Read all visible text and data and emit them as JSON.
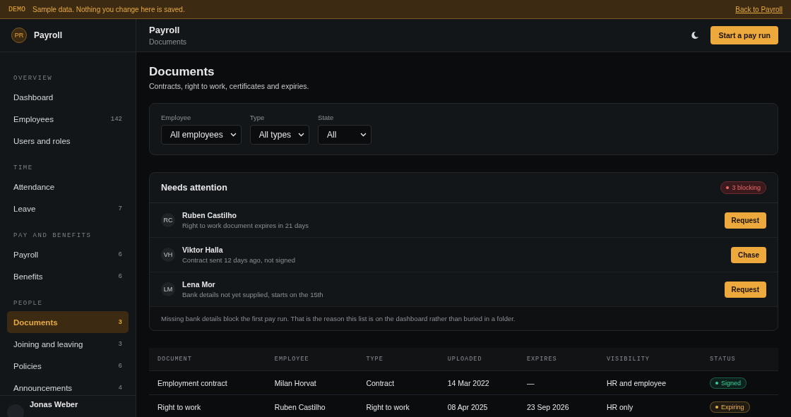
{
  "banner": {
    "tag": "DEMO",
    "message": "Sample data. Nothing you change here is saved.",
    "link": "Back to Payroll"
  },
  "sidebar": {
    "brand": {
      "initials": "PR",
      "name": "Payroll"
    },
    "sections": [
      {
        "title": "OVERVIEW",
        "items": [
          {
            "label": "Dashboard",
            "selected": false
          },
          {
            "label": "Employees",
            "count": "142",
            "selected": false
          },
          {
            "label": "Users and roles",
            "selected": false
          }
        ]
      },
      {
        "title": "TIME",
        "items": [
          {
            "label": "Attendance",
            "selected": false
          },
          {
            "label": "Leave",
            "count": "7",
            "selected": false
          }
        ]
      },
      {
        "title": "PAY AND BENEFITS",
        "items": [
          {
            "label": "Payroll",
            "count": "6",
            "selected": false
          },
          {
            "label": "Benefits",
            "count": "6",
            "selected": false
          }
        ]
      },
      {
        "title": "PEOPLE",
        "items": [
          {
            "label": "Documents",
            "count": "3",
            "selected": true
          },
          {
            "label": "Joining and leaving",
            "count": "3",
            "selected": false
          },
          {
            "label": "Policies",
            "count": "6",
            "selected": false
          },
          {
            "label": "Announcements",
            "count": "4",
            "selected": false
          }
        ]
      }
    ],
    "user": {
      "name": "Jonas Weber"
    }
  },
  "topbar": {
    "title": "Payroll",
    "breadcrumb": "Documents",
    "action": "Start a pay run"
  },
  "page": {
    "title": "Documents",
    "subtitle": "Contracts, right to work, certificates and expiries."
  },
  "filters": [
    {
      "label": "Employee",
      "value": "All employees"
    },
    {
      "label": "Type",
      "value": "All types"
    },
    {
      "label": "State",
      "value": "All"
    }
  ],
  "attention": {
    "title": "Needs attention",
    "badge": "3 blocking",
    "items": [
      {
        "initials": "RC",
        "name": "Ruben Castilho",
        "detail": "Right to work document expires in 21 days",
        "action": "Request"
      },
      {
        "initials": "VH",
        "name": "Viktor Halla",
        "detail": "Contract sent 12 days ago, not signed",
        "action": "Chase"
      },
      {
        "initials": "LM",
        "name": "Lena Mor",
        "detail": "Bank details not yet supplied, starts on the 15th",
        "action": "Request"
      }
    ],
    "note": "Missing bank details block the first pay run. That is the reason this list is on the dashboard rather than buried in a folder."
  },
  "table": {
    "columns": [
      "DOCUMENT",
      "EMPLOYEE",
      "TYPE",
      "UPLOADED",
      "EXPIRES",
      "VISIBILITY",
      "STATUS"
    ],
    "rows": [
      {
        "cells": [
          "Employment contract",
          "Milan Horvat",
          "Contract",
          "14 Mar 2022",
          "—",
          "HR and employee"
        ],
        "status": "Signed",
        "color": "#34d399"
      },
      {
        "cells": [
          "Right to work",
          "Ruben Castilho",
          "Right to work",
          "08 Apr 2025",
          "23 Sep 2026",
          "HR only"
        ],
        "status": "Expiring",
        "color": "#f0b442"
      }
    ]
  }
}
